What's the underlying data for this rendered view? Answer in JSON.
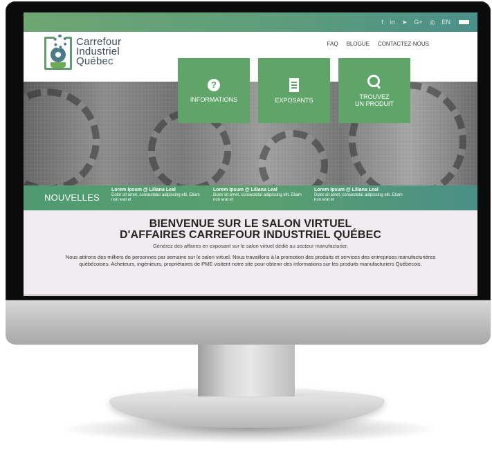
{
  "topbar": {
    "social": [
      {
        "icon": "facebook-icon",
        "glyph": "f"
      },
      {
        "icon": "linkedin-icon",
        "glyph": "in"
      },
      {
        "icon": "twitter-icon",
        "glyph": "🐦"
      },
      {
        "icon": "google-plus-icon",
        "glyph": "G+"
      },
      {
        "icon": "instagram-icon",
        "glyph": "◎"
      }
    ],
    "lang": "EN",
    "menu_icon": "hamburger-menu-icon"
  },
  "logo": {
    "line1": "Carrefour",
    "line2": "Industriel",
    "line3": "Québec"
  },
  "nav": {
    "faq": "FAQ",
    "blog": "BLOGUE",
    "contact": "CONTACTEZ-NOUS"
  },
  "tiles": [
    {
      "label": "INFORMATIONS",
      "icon": "question-icon"
    },
    {
      "label": "EXPOSANTS",
      "icon": "building-icon"
    },
    {
      "label_line1": "TROUVEZ",
      "label_line2": "UN PRODUIT",
      "icon": "search-icon"
    }
  ],
  "news": {
    "title": "NOUVELLES",
    "items": [
      {
        "title": "Lorem Ipsum @ Liliana Leal",
        "text": "Dolor sit amet, consectetur adipiscing elit. Etiam non erat et"
      },
      {
        "title": "Lorem Ipsum @ Liliana Leal",
        "text": "Dolor sit amet, consectetur adipiscing elit. Etiam non erat et"
      },
      {
        "title": "Lorem Ipsum @ Liliana Leal",
        "text": "Dolor sit amet, consectetur adipiscing elit. Etiam non erat et"
      }
    ]
  },
  "welcome": {
    "line1": "BIENVENUE SUR LE SALON VIRTUEL",
    "line2": "D'AFFAIRES CARREFOUR INDUSTRIEL QUÉBEC",
    "subtitle": "Générez des affaires en exposant sur le salon virtuel dédié au secteur manufacturier.",
    "paragraph": "Nous attirons des milliers de personnes par semaine sur le salon virtuel. Nous travaillons à la promotion des produits et services des entreprises manufacturières québécoises. Acheteurs, ingénieurs, propriétaires de PME visitent notre site pour obtenir des informations sur les produits manufacturiers Québécois."
  },
  "colors": {
    "brand_green": "#5fa56a",
    "topbar_teal": "#4c8f8a",
    "content_bg": "#efebee"
  }
}
